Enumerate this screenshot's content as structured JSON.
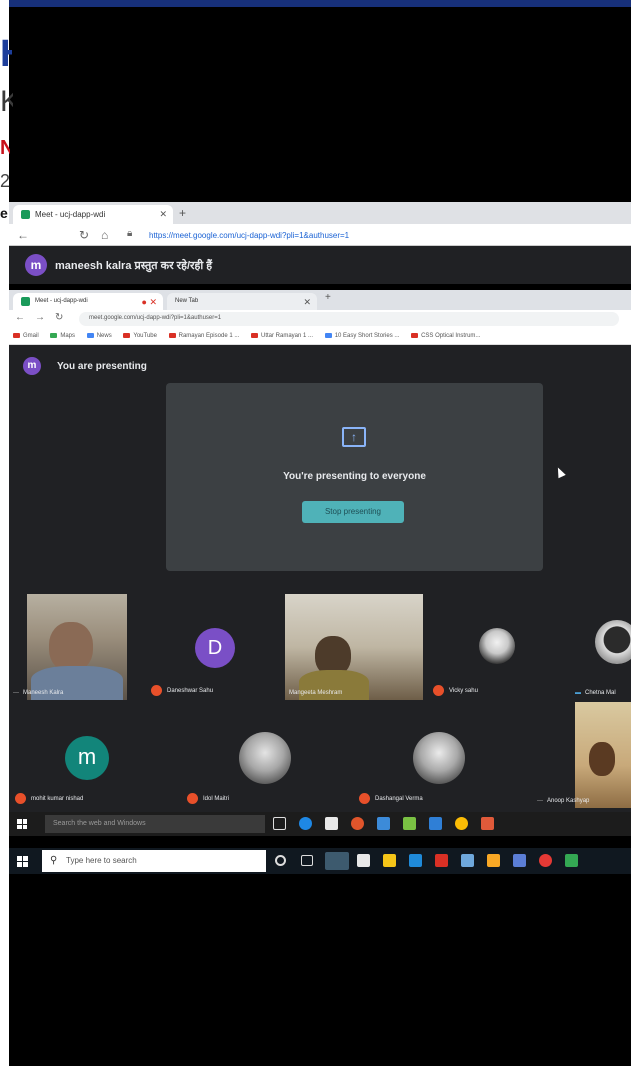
{
  "document": {
    "fragments": [
      "H",
      "K(",
      "N",
      "2",
      "e"
    ]
  },
  "outer_browser": {
    "tab_title": "Meet - ucj-dapp-wdi",
    "url": "https://meet.google.com/ucj-dapp-wdi?pli=1&authuser=1",
    "presenter_avatar": "m",
    "presenter_text": "maneesh kalra प्रस्तुत कर रहे/रही हैं"
  },
  "inner_browser": {
    "tab_title": "Meet - ucj-dapp-wdi",
    "tab2_title": "New Tab",
    "url": "meet.google.com/ucj-dapp-wdi?pli=1&authuser=1",
    "bookmarks": [
      "Gmail",
      "Maps",
      "News",
      "YouTube",
      "Ramayan Episode 1 ...",
      "Uttar Ramayan 1 ...",
      "10 Easy Short Stories ...",
      "CSS Optical Instrum..."
    ]
  },
  "meet": {
    "you_avatar": "m",
    "you_presenting": "You are presenting",
    "present_message": "You're presenting to everyone",
    "stop_button": "Stop presenting"
  },
  "participants": [
    {
      "name": "Maneesh Kalra",
      "type": "camera"
    },
    {
      "name": "Daneshwar Sahu",
      "type": "letter",
      "letter": "D",
      "color": "#7a4fc6"
    },
    {
      "name": "Mangeeta Meshram",
      "type": "camera"
    },
    {
      "name": "Vicky sahu",
      "type": "photo"
    },
    {
      "name": "Chetna Mal",
      "type": "photo"
    },
    {
      "name": "mohit kumar nishad",
      "type": "letter",
      "letter": "m",
      "color": "#12857a"
    },
    {
      "name": "Idol Maitri",
      "type": "photo"
    },
    {
      "name": "Dashangal Verma",
      "type": "photo"
    },
    {
      "name": "Anoop Kashyap",
      "type": "camera"
    }
  ],
  "taskbar1": {
    "search_placeholder": "Search the web and Windows"
  },
  "taskbar2": {
    "search_placeholder": "Type here to search"
  },
  "colors": {
    "meet_bg": "#202124",
    "present_card": "#3c4043",
    "stop_button": "#4fb2b8",
    "accent_blue": "#8ab4f8"
  }
}
